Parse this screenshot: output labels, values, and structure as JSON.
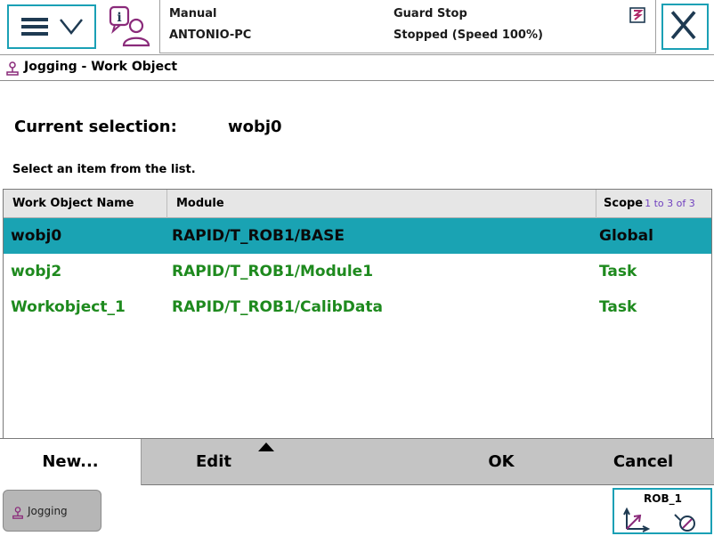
{
  "header": {
    "mode": "Manual",
    "host": "ANTONIO-PC",
    "guard_status": "Guard Stop",
    "run_status": "Stopped (Speed 100%)"
  },
  "title": "Jogging - Work Object",
  "selection": {
    "label": "Current selection:",
    "value": "wobj0"
  },
  "instruction": "Select an item from the list.",
  "list": {
    "columns": [
      "Work Object Name",
      "Module",
      "Scope"
    ],
    "count": "1 to 3 of 3",
    "rows": [
      {
        "name": "wobj0",
        "module": "RAPID/T_ROB1/BASE",
        "scope": "Global",
        "selected": true
      },
      {
        "name": "wobj2",
        "module": "RAPID/T_ROB1/Module1",
        "scope": "Task",
        "selected": false
      },
      {
        "name": "Workobject_1",
        "module": "RAPID/T_ROB1/CalibData",
        "scope": "Task",
        "selected": false
      }
    ]
  },
  "commands": {
    "new": "New...",
    "edit": "Edit",
    "ok": "OK",
    "cancel": "Cancel"
  },
  "taskbar": {
    "jogging": "Jogging",
    "robot": "ROB_1"
  },
  "colors": {
    "accent": "#1aa0b5",
    "selected_row": "#1aa3b3",
    "row_text": "#1e8a1e",
    "command_bar": "#c4c4c4"
  }
}
